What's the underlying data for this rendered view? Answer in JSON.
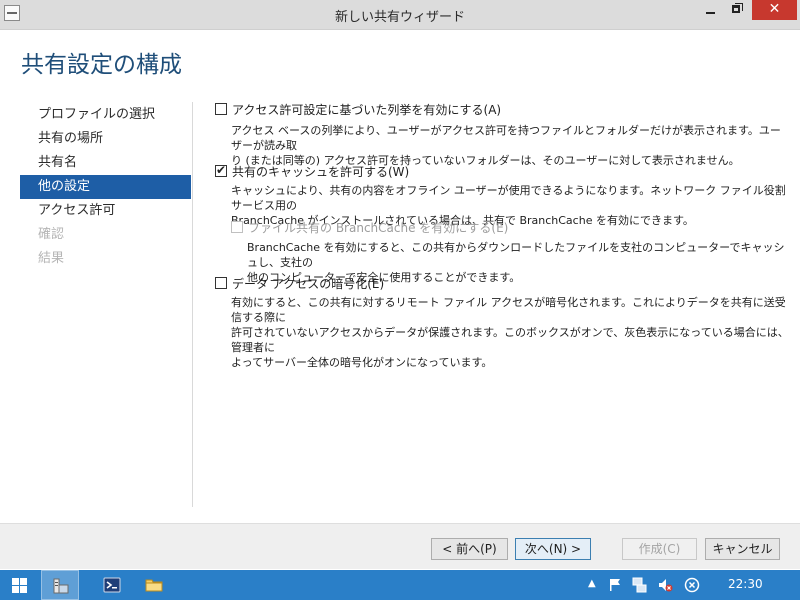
{
  "window": {
    "title": "新しい共有ウィザード"
  },
  "header": {
    "title": "共有設定の構成"
  },
  "nav": {
    "items": [
      {
        "label": "プロファイルの選択",
        "state": "normal"
      },
      {
        "label": "共有の場所",
        "state": "normal"
      },
      {
        "label": "共有名",
        "state": "normal"
      },
      {
        "label": "他の設定",
        "state": "active"
      },
      {
        "label": "アクセス許可",
        "state": "normal"
      },
      {
        "label": "確認",
        "state": "disabled"
      },
      {
        "label": "結果",
        "state": "disabled"
      }
    ]
  },
  "options": {
    "access_enum": {
      "label": "アクセス許可設定に基づいた列挙を有効にする(A)",
      "checked": false,
      "desc_line1": "アクセス ベースの列挙により、ユーザーがアクセス許可を持つファイルとフォルダーだけが表示されます。ユーザーが読み取",
      "desc_line2": "り (または同等の) アクセス許可を持っていないフォルダーは、そのユーザーに対して表示されません。"
    },
    "caching": {
      "label": "共有のキャッシュを許可する(W)",
      "checked": true,
      "desc_line1": "キャッシュにより、共有の内容をオフライン ユーザーが使用できるようになります。ネットワーク ファイル役割サービス用の",
      "desc_line2": "BranchCache がインストールされている場合は、共有で BranchCache を有効にできます。"
    },
    "branchcache": {
      "label": "ファイル共有の BranchCache を有効にする(E)",
      "checked": false,
      "disabled": true,
      "desc_line1": "BranchCache を有効にすると、この共有からダウンロードしたファイルを支社のコンピューターでキャッシュし、支社の",
      "desc_line2": "他のコンピューターで安全に使用することができます。"
    },
    "encrypt": {
      "label": "データ アクセスの暗号化(E)",
      "checked": false,
      "desc_line1": "有効にすると、この共有に対するリモート ファイル アクセスが暗号化されます。これによりデータを共有に送受信する際に",
      "desc_line2": "許可されていないアクセスからデータが保護されます。このボックスがオンで、灰色表示になっている場合には、管理者に",
      "desc_line3": "よってサーバー全体の暗号化がオンになっています。"
    }
  },
  "buttons": {
    "prev": "< 前へ(P)",
    "next": "次へ(N) >",
    "create": "作成(C)",
    "cancel": "キャンセル"
  },
  "taskbar": {
    "clock": "22:30"
  },
  "colors": {
    "accent": "#1e5ea6",
    "title_text": "#1f4e79",
    "taskbar": "#2a7fc8",
    "close": "#c7382e"
  }
}
